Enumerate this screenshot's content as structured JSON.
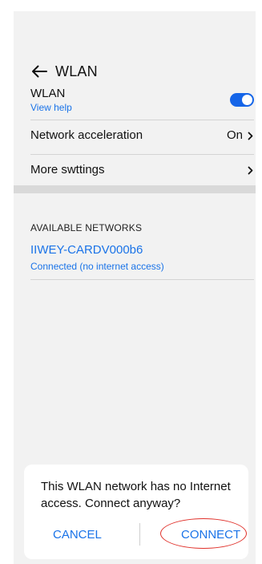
{
  "header": {
    "title": "WLAN",
    "back_icon": "arrow-left-icon"
  },
  "settings": {
    "wlan": {
      "label": "WLAN",
      "help_link": "View help",
      "toggle_on": true
    },
    "network_acceleration": {
      "label": "Network acceleration",
      "value": "On"
    },
    "more_settings": {
      "label": "More swttings"
    }
  },
  "available_networks": {
    "header": "AVAILABLE NETWORKS",
    "items": [
      {
        "name": "IIWEY-CARDV000b6",
        "status": "Connected (no internet access)"
      }
    ]
  },
  "dialog": {
    "message": "This WLAN network has no Internet access. Connect anyway?",
    "cancel_label": "CANCEL",
    "connect_label": "CONNECT"
  },
  "colors": {
    "accent": "#1a73e8",
    "toggle": "#1565e8",
    "background": "#f2f2f2",
    "highlight": "#e0302a"
  }
}
